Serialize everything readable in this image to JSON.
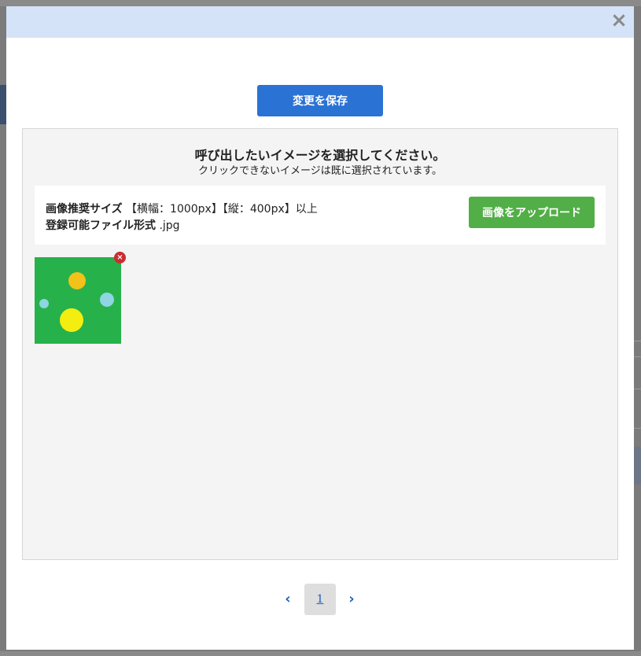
{
  "modal": {
    "close_label": "×",
    "save_label": "変更を保存",
    "title": "呼び出したいイメージを選択してください。",
    "subtitle": "クリックできないイメージは既に選択されています。",
    "info": {
      "size_label": "画像推奨サイズ",
      "size_value": "【横幅：1000px】【縦：400px】以上",
      "format_label": "登録可能ファイル形式",
      "format_value": ".jpg"
    },
    "upload_label": "画像をアップロード",
    "delete_badge": "×"
  },
  "pagination": {
    "prev": "‹",
    "current_page": "1",
    "next": "›"
  },
  "colors": {
    "header": "#d4e3f7",
    "save_button": "#2a72d4",
    "upload_button": "#52ae47",
    "thumbnail_bg": "#27b14a",
    "delete_badge": "#cc2b30",
    "link": "#1f5fb8"
  },
  "icons": {
    "close": "close-icon",
    "delete": "delete-icon",
    "prev": "chevron-left-icon",
    "next": "chevron-right-icon"
  }
}
